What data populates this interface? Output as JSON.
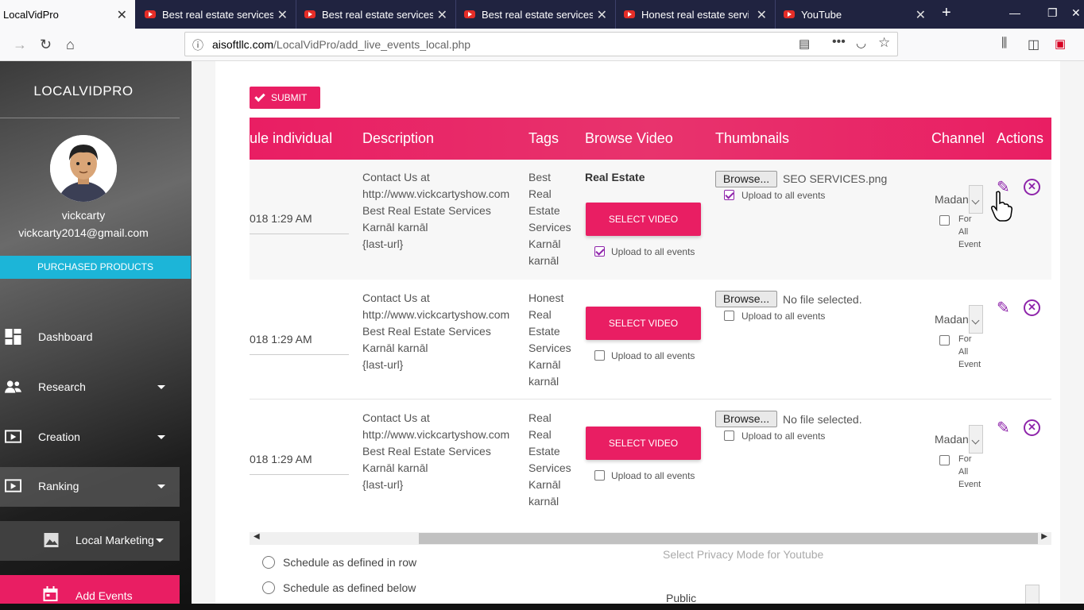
{
  "browser": {
    "tabs": [
      {
        "title": "LocalVidPro",
        "active": true
      },
      {
        "title": "Best real estate services K",
        "active": false
      },
      {
        "title": "Best real estate services K",
        "active": false
      },
      {
        "title": "Best real estate services K",
        "active": false
      },
      {
        "title": "Honest real estate service",
        "active": false
      },
      {
        "title": "YouTube",
        "active": false
      }
    ],
    "url_domain": "aisoftllc.com",
    "url_path": "/LocalVidPro/add_live_events_local.php"
  },
  "sidebar": {
    "brand": "LOCALVIDPRO",
    "username": "vickcarty",
    "email": "vickcarty2014@gmail.com",
    "purchased_label": "PURCHASED PRODUCTS",
    "items": [
      {
        "label": "Dashboard"
      },
      {
        "label": "Research"
      },
      {
        "label": "Creation"
      },
      {
        "label": "Ranking"
      },
      {
        "label": "Local Marketing"
      },
      {
        "label": "Add Events"
      }
    ]
  },
  "main": {
    "submit_label": "SUBMIT",
    "columns": [
      "ule individual",
      "Description",
      "Tags",
      "Browse Video",
      "Thumbnails",
      "Channel",
      "Actions"
    ],
    "select_video_label": "SELECT VIDEO",
    "upload_all_label": "Upload to all events",
    "browse_label": "Browse...",
    "for_all_label": [
      "For",
      "All",
      "Event"
    ],
    "rows": [
      {
        "datetime": "018 1:29 AM",
        "description": [
          "Contact Us at",
          "http://www.vickcartyshow.com",
          "Best Real Estate Services",
          "Karnāl karnāl",
          "{last-url}"
        ],
        "tags": [
          "Best",
          "Real",
          "Estate",
          "Services",
          "Karnāl",
          "karnāl"
        ],
        "video_title": "Real Estate",
        "video_upload_checked": true,
        "thumb_file": "SEO SERVICES.png",
        "thumb_upload_checked": true,
        "channel": "Madan"
      },
      {
        "datetime": "018 1:29 AM",
        "description": [
          "Contact Us at",
          "http://www.vickcartyshow.com",
          "Best Real Estate Services",
          "Karnāl karnāl",
          "{last-url}"
        ],
        "tags": [
          "Honest",
          "Real",
          "Estate",
          "Services",
          "Karnāl",
          "karnāl"
        ],
        "video_title": "",
        "video_upload_checked": false,
        "thumb_file": "No file selected.",
        "thumb_upload_checked": false,
        "channel": "Madan"
      },
      {
        "datetime": "018 1:29 AM",
        "description": [
          "Contact Us at",
          "http://www.vickcartyshow.com",
          "Best Real Estate Services",
          "Karnāl karnāl",
          "{last-url}"
        ],
        "tags": [
          "Real",
          "Real",
          "Estate",
          "Services",
          "Karnāl",
          "karnāl"
        ],
        "video_title": "",
        "video_upload_checked": false,
        "thumb_file": "No file selected.",
        "thumb_upload_checked": false,
        "channel": "Madan"
      }
    ],
    "schedule_options": [
      "Schedule as defined in row",
      "Schedule as defined below"
    ],
    "privacy_label": "Select Privacy Mode for Youtube",
    "privacy_value": "Public"
  },
  "colors": {
    "accent": "#e91e63",
    "purchased": "#1cb5d8",
    "action": "#8e24aa",
    "tabbar": "#202340"
  }
}
